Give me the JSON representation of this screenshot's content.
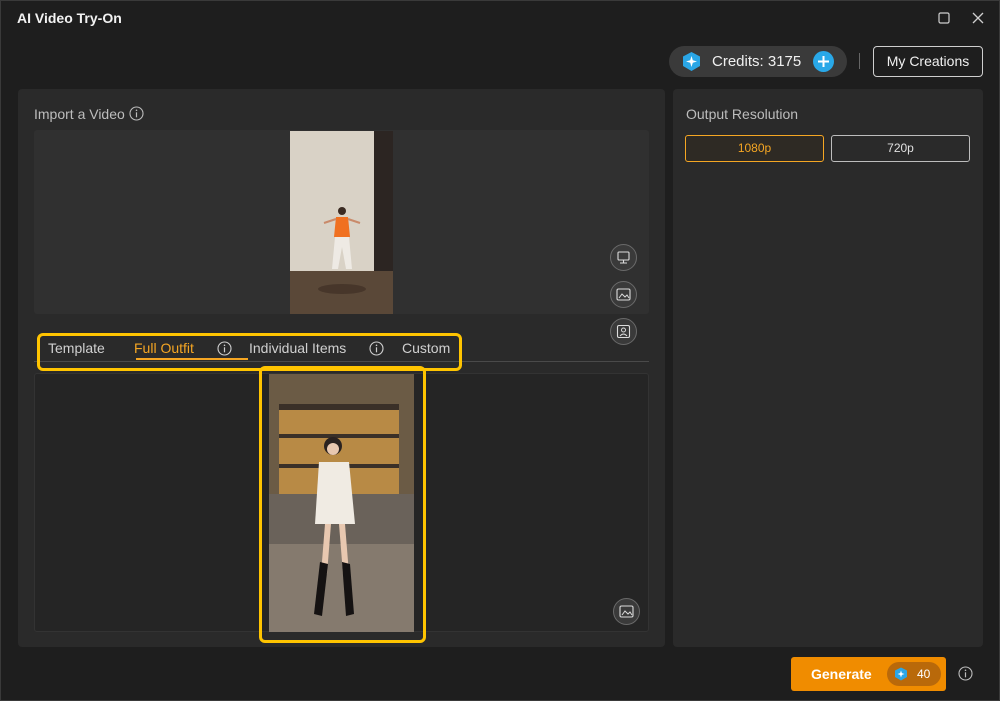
{
  "window": {
    "title": "AI Video Try-On",
    "maximize_icon": "maximize-icon",
    "close_icon": "close-icon"
  },
  "header": {
    "credits_label": "Credits: 3175",
    "credits_icon": "gem-icon",
    "add_credits_icon": "plus-icon",
    "my_creations_label": "My Creations"
  },
  "import": {
    "label": "Import a Video",
    "info_icon": "info-icon",
    "tools": [
      "swap-person-icon",
      "replace-image-icon",
      "portrait-frame-icon"
    ]
  },
  "tabs": [
    {
      "label": "Template",
      "active": false
    },
    {
      "label": "Full Outfit",
      "active": true,
      "has_info": true
    },
    {
      "label": "Individual Items",
      "active": false,
      "has_info": true
    },
    {
      "label": "Custom",
      "active": false
    }
  ],
  "outfit": {
    "replace_icon": "replace-image-icon"
  },
  "output": {
    "label": "Output Resolution",
    "options": [
      "1080p",
      "720p"
    ],
    "selected": "1080p"
  },
  "generate": {
    "label": "Generate",
    "cost": "40"
  },
  "colors": {
    "accent": "#f5a623",
    "highlight": "#ffc400",
    "generate": "#f08c00",
    "credits_add": "#29a8e8"
  }
}
